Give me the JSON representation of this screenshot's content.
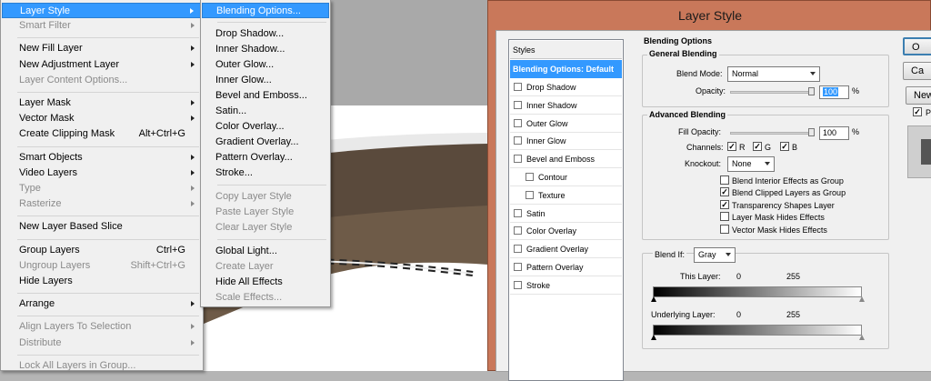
{
  "menu": {
    "items": [
      {
        "label": "Layer Style",
        "state": "highlighted",
        "submenu": true
      },
      {
        "label": "Smart Filter",
        "state": "disabled",
        "submenu": true
      },
      {
        "sep": true
      },
      {
        "label": "New Fill Layer",
        "state": "enabled",
        "submenu": true
      },
      {
        "label": "New Adjustment Layer",
        "state": "enabled",
        "submenu": true
      },
      {
        "label": "Layer Content Options...",
        "state": "disabled"
      },
      {
        "sep": true
      },
      {
        "label": "Layer Mask",
        "state": "enabled",
        "submenu": true
      },
      {
        "label": "Vector Mask",
        "state": "enabled",
        "submenu": true
      },
      {
        "label": "Create Clipping Mask",
        "state": "enabled",
        "shortcut": "Alt+Ctrl+G"
      },
      {
        "sep": true
      },
      {
        "label": "Smart Objects",
        "state": "enabled",
        "submenu": true
      },
      {
        "label": "Video Layers",
        "state": "enabled",
        "submenu": true
      },
      {
        "label": "Type",
        "state": "disabled",
        "submenu": true
      },
      {
        "label": "Rasterize",
        "state": "disabled",
        "submenu": true
      },
      {
        "sep": true
      },
      {
        "label": "New Layer Based Slice",
        "state": "enabled"
      },
      {
        "sep": true
      },
      {
        "label": "Group Layers",
        "state": "enabled",
        "shortcut": "Ctrl+G"
      },
      {
        "label": "Ungroup Layers",
        "state": "disabled",
        "shortcut": "Shift+Ctrl+G"
      },
      {
        "label": "Hide Layers",
        "state": "enabled"
      },
      {
        "sep": true
      },
      {
        "label": "Arrange",
        "state": "enabled",
        "submenu": true
      },
      {
        "sep": true
      },
      {
        "label": "Align Layers To Selection",
        "state": "disabled",
        "submenu": true
      },
      {
        "label": "Distribute",
        "state": "disabled",
        "submenu": true
      },
      {
        "sep": true
      },
      {
        "label": "Lock All Layers in Group...",
        "state": "disabled"
      }
    ]
  },
  "submenu": {
    "items": [
      {
        "label": "Blending Options...",
        "state": "highlighted"
      },
      {
        "sep": true
      },
      {
        "label": "Drop Shadow...",
        "state": "enabled"
      },
      {
        "label": "Inner Shadow...",
        "state": "enabled"
      },
      {
        "label": "Outer Glow...",
        "state": "enabled"
      },
      {
        "label": "Inner Glow...",
        "state": "enabled"
      },
      {
        "label": "Bevel and Emboss...",
        "state": "enabled"
      },
      {
        "label": "Satin...",
        "state": "enabled"
      },
      {
        "label": "Color Overlay...",
        "state": "enabled"
      },
      {
        "label": "Gradient Overlay...",
        "state": "enabled"
      },
      {
        "label": "Pattern Overlay...",
        "state": "enabled"
      },
      {
        "label": "Stroke...",
        "state": "enabled"
      },
      {
        "sep": true
      },
      {
        "label": "Copy Layer Style",
        "state": "disabled"
      },
      {
        "label": "Paste Layer Style",
        "state": "disabled"
      },
      {
        "label": "Clear Layer Style",
        "state": "disabled"
      },
      {
        "sep": true
      },
      {
        "label": "Global Light...",
        "state": "enabled"
      },
      {
        "label": "Create Layer",
        "state": "disabled"
      },
      {
        "label": "Hide All Effects",
        "state": "enabled"
      },
      {
        "label": "Scale Effects...",
        "state": "disabled"
      }
    ]
  },
  "dialog": {
    "title": "Layer Style",
    "styles_header": "Styles",
    "styles_selected": "Blending Options: Default",
    "styles": [
      {
        "label": "Drop Shadow",
        "checked": false,
        "indent": false
      },
      {
        "label": "Inner Shadow",
        "checked": false,
        "indent": false
      },
      {
        "label": "Outer Glow",
        "checked": false,
        "indent": false
      },
      {
        "label": "Inner Glow",
        "checked": false,
        "indent": false
      },
      {
        "label": "Bevel and Emboss",
        "checked": false,
        "indent": false
      },
      {
        "label": "Contour",
        "checked": false,
        "indent": true
      },
      {
        "label": "Texture",
        "checked": false,
        "indent": true
      },
      {
        "label": "Satin",
        "checked": false,
        "indent": false
      },
      {
        "label": "Color Overlay",
        "checked": false,
        "indent": false
      },
      {
        "label": "Gradient Overlay",
        "checked": false,
        "indent": false
      },
      {
        "label": "Pattern Overlay",
        "checked": false,
        "indent": false
      },
      {
        "label": "Stroke",
        "checked": false,
        "indent": false
      }
    ],
    "blending_options_title": "Blending Options",
    "general_title": "General Blending",
    "blend_mode_label": "Blend Mode:",
    "blend_mode_value": "Normal",
    "opacity_label": "Opacity:",
    "opacity_value": "100",
    "percent": "%",
    "advanced_title": "Advanced Blending",
    "fill_opacity_label": "Fill Opacity:",
    "fill_opacity_value": "100",
    "channels_label": "Channels:",
    "channel_r": "R",
    "channel_g": "G",
    "channel_b": "B",
    "knockout_label": "Knockout:",
    "knockout_value": "None",
    "checks": [
      {
        "label": "Blend Interior Effects as Group",
        "checked": false
      },
      {
        "label": "Blend Clipped Layers as Group",
        "checked": true
      },
      {
        "label": "Transparency Shapes Layer",
        "checked": true
      },
      {
        "label": "Layer Mask Hides Effects",
        "checked": false
      },
      {
        "label": "Vector Mask Hides Effects",
        "checked": false
      }
    ],
    "blend_if_label": "Blend If:",
    "blend_if_value": "Gray",
    "this_layer_label": "This Layer:",
    "this_layer_min": "0",
    "this_layer_max": "255",
    "underlying_label": "Underlying Layer:",
    "underlying_min": "0",
    "underlying_max": "255",
    "btn_ok": "O",
    "btn_cancel": "Ca",
    "btn_new": "New",
    "preview_check": "P",
    "check_mark": "✓"
  },
  "colors": {
    "highlight": "#3399ff",
    "dialog_frame": "#c9785a"
  }
}
